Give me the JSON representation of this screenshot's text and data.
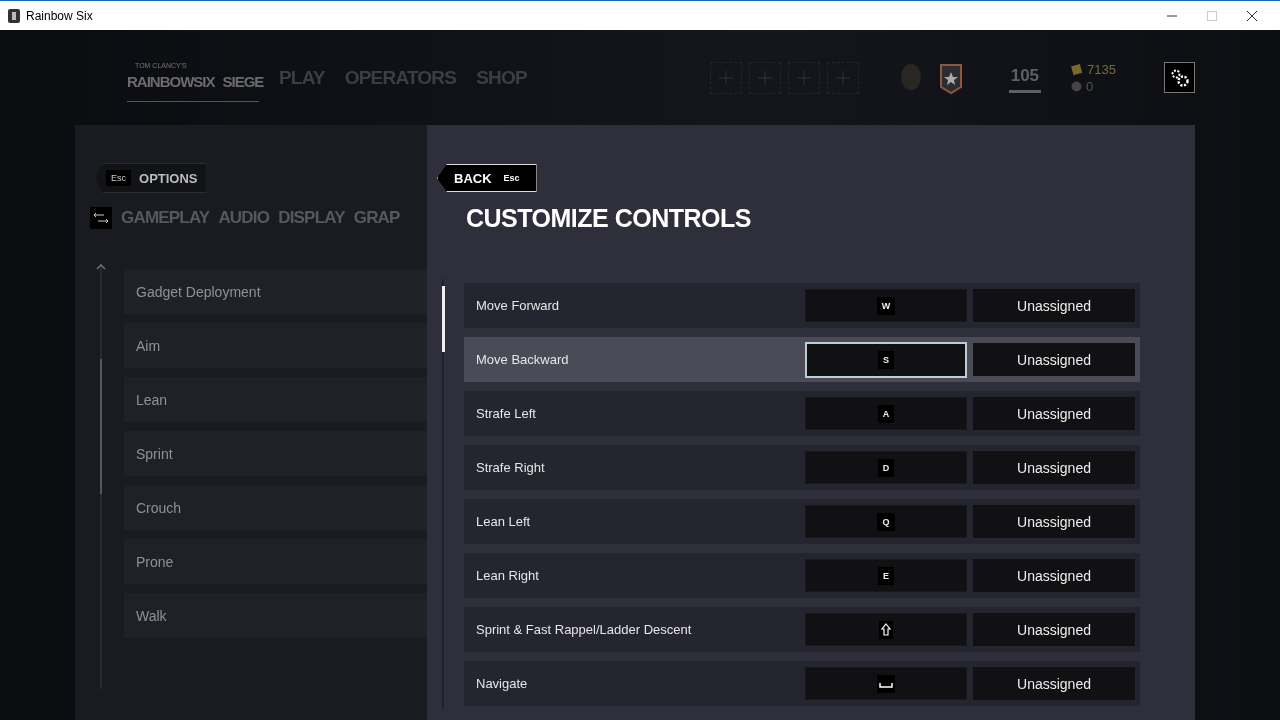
{
  "window": {
    "title": "Rainbow Six"
  },
  "header": {
    "logo": {
      "small": "TOM CLANCY'S",
      "left": "RAINBOWSIX",
      "right": "SIEGE"
    },
    "nav": [
      {
        "label": "PLAY"
      },
      {
        "label": "OPERATORS"
      },
      {
        "label": "SHOP"
      }
    ],
    "level": "105",
    "credits": "7135",
    "premium": "0"
  },
  "options_panel": {
    "back": {
      "key": "Esc",
      "label": "OPTIONS"
    },
    "tabs": [
      {
        "label": "GAMEPLAY",
        "selected": false
      },
      {
        "label": "AUDIO",
        "selected": false
      },
      {
        "label": "DISPLAY",
        "selected": false
      },
      {
        "label": "GRAP",
        "selected": false
      }
    ],
    "items": [
      "Gadget Deployment",
      "Aim",
      "Lean",
      "Sprint",
      "Crouch",
      "Prone",
      "Walk"
    ]
  },
  "controls_panel": {
    "back": {
      "label": "BACK",
      "key": "Esc"
    },
    "title": "CUSTOMIZE CONTROLS",
    "rows": [
      {
        "action": "Move Forward",
        "key": {
          "kind": "letter",
          "label": "W"
        },
        "alternate": "Unassigned",
        "selected": false
      },
      {
        "action": "Move Backward",
        "key": {
          "kind": "letter",
          "label": "S"
        },
        "alternate": "Unassigned",
        "selected": true
      },
      {
        "action": "Strafe Left",
        "key": {
          "kind": "letter",
          "label": "A"
        },
        "alternate": "Unassigned",
        "selected": false
      },
      {
        "action": "Strafe Right",
        "key": {
          "kind": "letter",
          "label": "D"
        },
        "alternate": "Unassigned",
        "selected": false
      },
      {
        "action": "Lean Left",
        "key": {
          "kind": "letter",
          "label": "Q"
        },
        "alternate": "Unassigned",
        "selected": false
      },
      {
        "action": "Lean Right",
        "key": {
          "kind": "letter",
          "label": "E"
        },
        "alternate": "Unassigned",
        "selected": false
      },
      {
        "action": "Sprint & Fast Rappel/Ladder Descent",
        "key": {
          "kind": "shift"
        },
        "alternate": "Unassigned",
        "selected": false
      },
      {
        "action": "Navigate",
        "key": {
          "kind": "space"
        },
        "alternate": "Unassigned",
        "selected": false
      }
    ]
  }
}
